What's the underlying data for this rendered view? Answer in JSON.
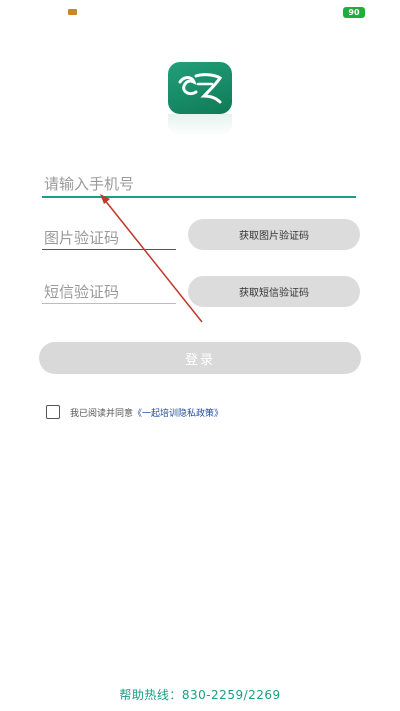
{
  "status_bar": {
    "battery_level": "90",
    "left_icon": "notification-icon"
  },
  "logo": {
    "icon": "app-logo-icon",
    "color": "#1a9472"
  },
  "form": {
    "phone_placeholder": "请输入手机号",
    "image_code_placeholder": "图片验证码",
    "image_code_button": "获取图片验证码",
    "sms_code_placeholder": "短信验证码",
    "sms_code_button": "获取短信验证码",
    "login_button": "登录"
  },
  "agreement": {
    "checked": false,
    "text": "我已阅读并同意",
    "link": "《一起培训隐私政策》"
  },
  "footer": {
    "hotline": "帮助热线：830-2259/2269"
  },
  "colors": {
    "accent": "#16a085",
    "button_bg": "#dcdcdc",
    "link": "#1f4fa0",
    "annotation_arrow": "#c0392b"
  }
}
